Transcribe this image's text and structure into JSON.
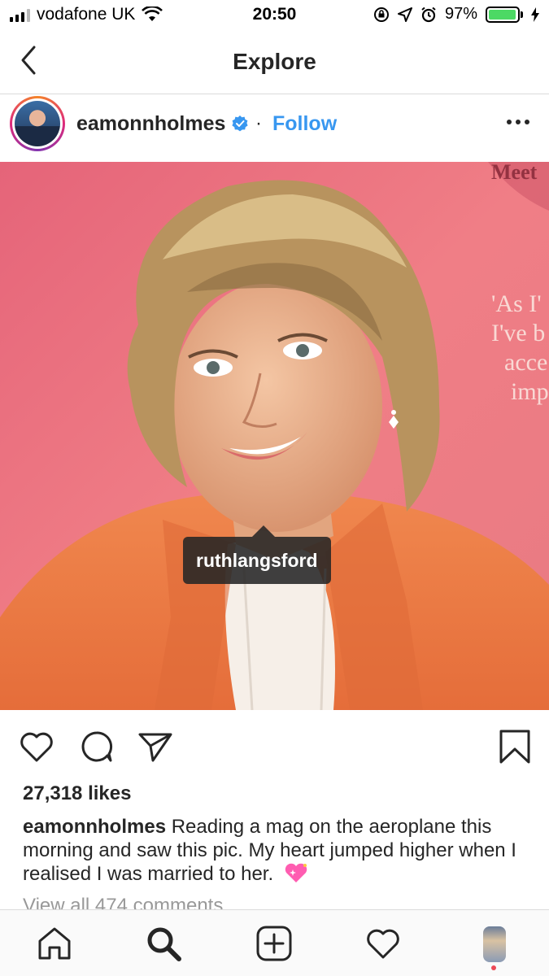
{
  "status_bar": {
    "carrier": "vodafone UK",
    "time": "20:50",
    "battery_percent": "97%",
    "battery_level": 0.97,
    "icons": [
      "signal-icon",
      "wifi-icon",
      "rotation-lock-icon",
      "location-icon",
      "alarm-icon",
      "battery-icon",
      "charging-icon"
    ]
  },
  "nav": {
    "title": "Explore",
    "back_icon": "chevron-left-icon"
  },
  "post": {
    "username": "eamonnholmes",
    "verified": true,
    "separator": "·",
    "follow_label": "Follow",
    "photo": {
      "tag_label": "ruthlangsford",
      "magazine_text": [
        "Meet",
        "'As I'",
        "I've b",
        "acce",
        "imp"
      ]
    },
    "likes": "27,318 likes",
    "caption_username": "eamonnholmes",
    "caption_text": "Reading a mag on the aeroplane this morning and saw this pic. My heart jumped higher when I realised I was married to her.",
    "view_comments": "View all 474 comments"
  },
  "colors": {
    "accent": "#3897f0",
    "text": "#262626",
    "muted": "#999999",
    "notification": "#ed4956",
    "photo_bg": "#ef7d84"
  },
  "tabbar": {
    "tabs": [
      "home-icon",
      "search-icon",
      "add-post-icon",
      "activity-heart-icon",
      "profile-avatar"
    ]
  }
}
